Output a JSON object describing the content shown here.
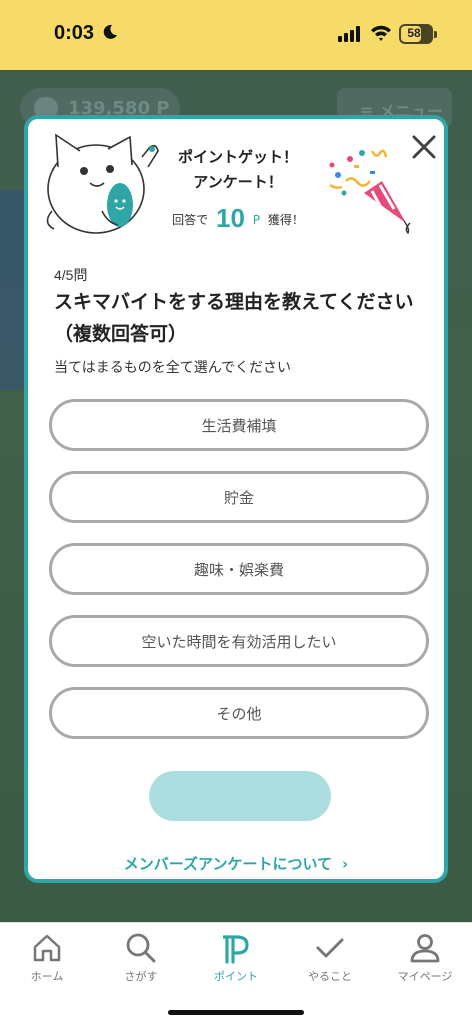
{
  "status_bar": {
    "time": "0:03",
    "battery": "58",
    "icons": [
      "moon-icon",
      "signal-icon",
      "wifi-icon",
      "battery-icon"
    ]
  },
  "background": {
    "points": "139,580 P",
    "menu_label": "≡ メニュー"
  },
  "modal": {
    "header": {
      "line1": "ポイントゲット！",
      "line2": "アンケート！",
      "reward_prefix": "回答で",
      "reward_value": "10",
      "reward_unit": "P",
      "reward_suffix": "獲得！"
    },
    "progress": "4/5問",
    "question": "スキマバイトをする理由を教えてください（複数回答可）",
    "instruction": "当てはまるものを全て選んでください",
    "options": [
      {
        "label": "生活費補填"
      },
      {
        "label": "貯金"
      },
      {
        "label": "趣味・娯楽費"
      },
      {
        "label": "空いた時間を有効活用したい"
      },
      {
        "label": "その他"
      }
    ],
    "submit_label": "",
    "about_link": "メンバーズアンケートについて",
    "about_chevron": "›"
  },
  "tabbar": {
    "tabs": [
      {
        "label": "ホーム",
        "icon": "home-icon"
      },
      {
        "label": "さがす",
        "icon": "search-icon"
      },
      {
        "label": "ポイント",
        "icon": "points-icon"
      },
      {
        "label": "やること",
        "icon": "check-icon"
      },
      {
        "label": "マイページ",
        "icon": "person-icon"
      }
    ],
    "active_index": 2
  },
  "colors": {
    "accent": "#2EA6A6",
    "status_bar": "#F7DB69",
    "submit_disabled": "#ADDEDF",
    "option_border": "#A9A9A9"
  }
}
